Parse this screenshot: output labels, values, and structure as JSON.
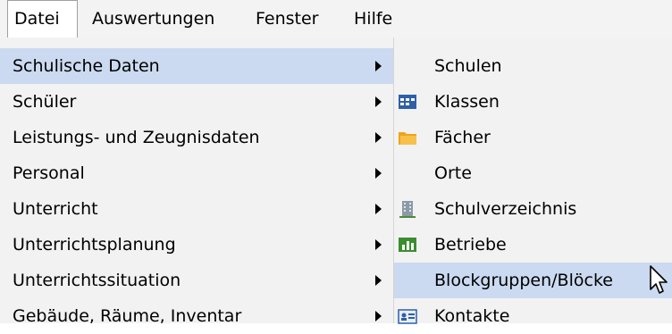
{
  "menubar": {
    "items": [
      {
        "label": "Datei",
        "active": true
      },
      {
        "label": "Auswertungen"
      },
      {
        "label": "Fenster"
      },
      {
        "label": "Hilfe"
      }
    ]
  },
  "main_menu": {
    "items": [
      {
        "label": "Schulische Daten"
      },
      {
        "label": "Schüler"
      },
      {
        "label": "Leistungs- und Zeugnisdaten"
      },
      {
        "label": "Personal"
      },
      {
        "label": "Unterricht"
      },
      {
        "label": "Unterrichtsplanung"
      },
      {
        "label": "Unterrichtssituation"
      },
      {
        "label": "Gebäude, Räume, Inventar"
      }
    ],
    "highlighted": "Schulische Daten"
  },
  "sub_menu": {
    "items": [
      {
        "label": "Schulen",
        "icon": "none"
      },
      {
        "label": "Klassen",
        "icon": "class-table-icon"
      },
      {
        "label": "Fächer",
        "icon": "folders-icon"
      },
      {
        "label": "Orte",
        "icon": "none"
      },
      {
        "label": "Schulverzeichnis",
        "icon": "building-icon"
      },
      {
        "label": "Betriebe",
        "icon": "bar-chart-icon"
      },
      {
        "label": "Blockgruppen/Blöcke",
        "icon": "none"
      },
      {
        "label": "Kontakte",
        "icon": "contact-card-icon"
      }
    ],
    "highlighted": "Blockgruppen/Blöcke"
  },
  "colors": {
    "menubar_bg": "#f3f3f3",
    "menu_bg": "#f2f2f2",
    "highlight": "#cbdaf0"
  }
}
